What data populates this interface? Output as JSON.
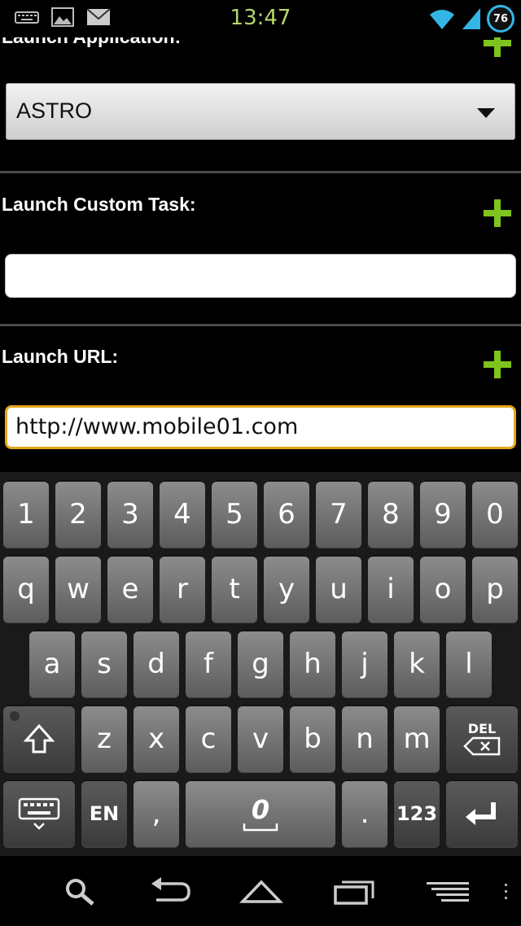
{
  "status_bar": {
    "time": "13:47",
    "battery_level": "76",
    "left_icons": [
      "keyboard-icon",
      "image-icon",
      "mail-icon"
    ],
    "right_icons": [
      "wifi-icon",
      "signal-icon"
    ]
  },
  "form": {
    "section_application": {
      "label": "Launch Application:",
      "selected_value": "ASTRO"
    },
    "section_custom_task": {
      "label": "Launch Custom Task:",
      "value": ""
    },
    "section_url": {
      "label": "Launch URL:",
      "value": "http://www.mobile01.com"
    },
    "accent_color": "#7fc41e",
    "focus_color": "#e3a71c"
  },
  "keyboard": {
    "row_numbers": [
      "1",
      "2",
      "3",
      "4",
      "5",
      "6",
      "7",
      "8",
      "9",
      "0"
    ],
    "row_top": [
      "q",
      "w",
      "e",
      "r",
      "t",
      "y",
      "u",
      "i",
      "o",
      "p"
    ],
    "row_middle": [
      "a",
      "s",
      "d",
      "f",
      "g",
      "h",
      "j",
      "k",
      "l"
    ],
    "row_bottom": [
      "z",
      "x",
      "c",
      "v",
      "b",
      "n",
      "m"
    ],
    "del_label": "DEL",
    "lang_label": "EN",
    "comma_label": ",",
    "period_label": ".",
    "numbers_label": "123",
    "space_logo": "0"
  },
  "nav_bar": {
    "icons": [
      "search-icon",
      "back-icon",
      "home-icon",
      "recent-apps-icon",
      "menu-icon"
    ]
  }
}
